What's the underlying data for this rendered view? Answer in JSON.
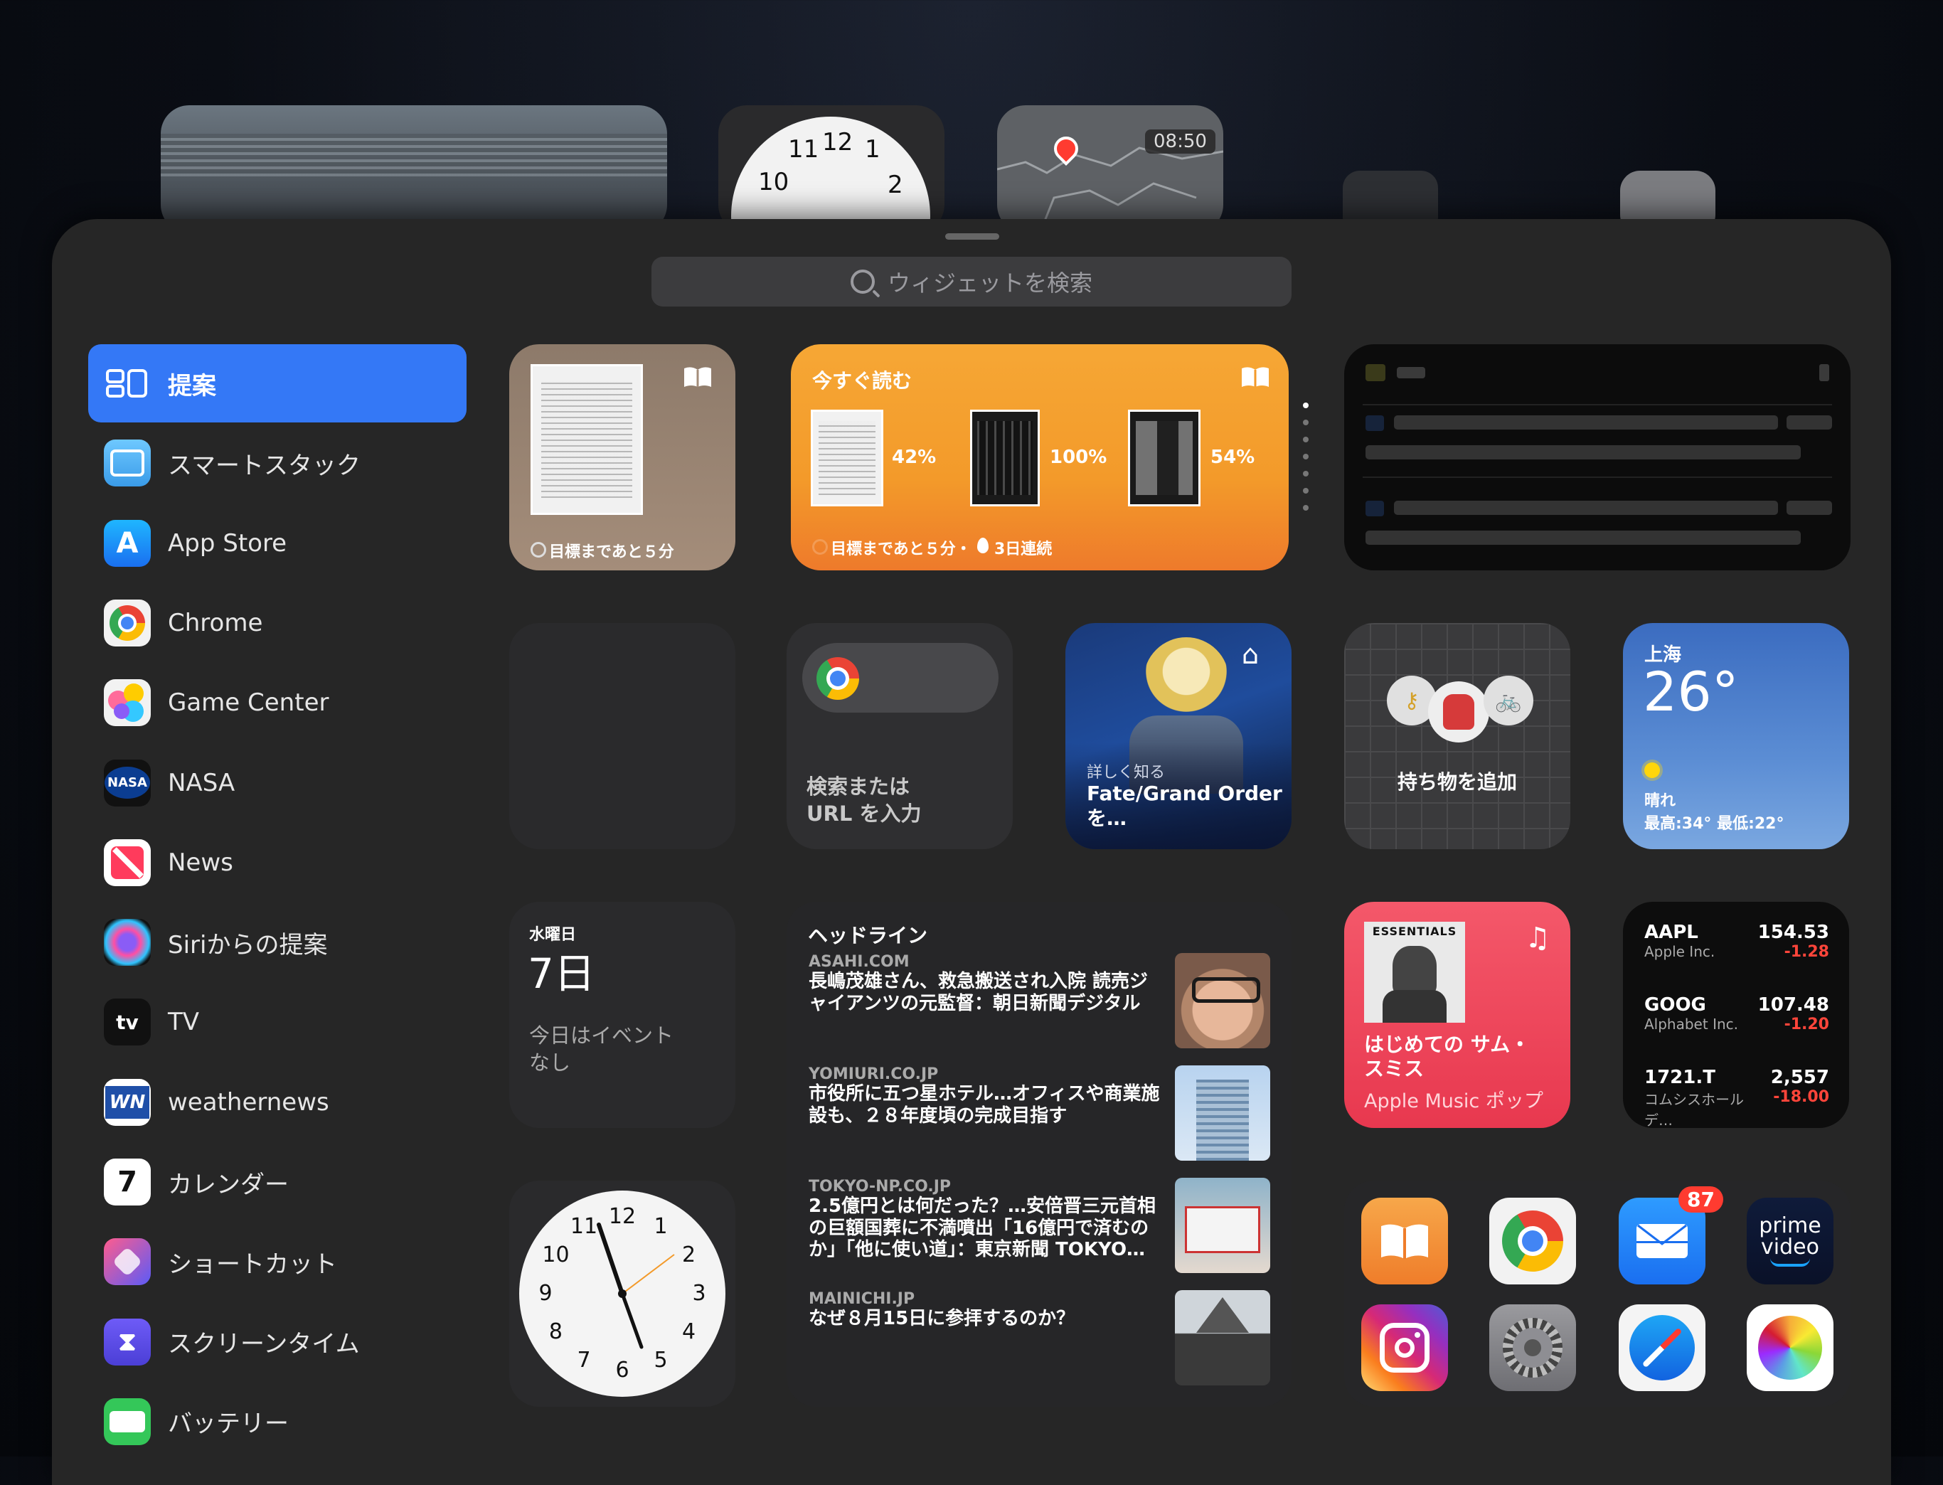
{
  "background": {
    "clock_numbers": [
      "11",
      "12",
      "1",
      "10",
      "2"
    ],
    "map_time": "08:50"
  },
  "search": {
    "placeholder": "ウィジェットを検索"
  },
  "sidebar": {
    "items": [
      {
        "label": "提案",
        "icon": "suggestions-icon",
        "active": true
      },
      {
        "label": "スマートスタック",
        "icon": "smart-stack-icon"
      },
      {
        "label": "App Store",
        "icon": "app-store-icon"
      },
      {
        "label": "Chrome",
        "icon": "chrome-icon"
      },
      {
        "label": "Game Center",
        "icon": "game-center-icon"
      },
      {
        "label": "NASA",
        "icon": "nasa-icon",
        "icon_text": "NASA"
      },
      {
        "label": "News",
        "icon": "news-icon"
      },
      {
        "label": "Siriからの提案",
        "icon": "siri-icon"
      },
      {
        "label": "TV",
        "icon": "tv-icon",
        "icon_text": "tv"
      },
      {
        "label": "weathernews",
        "icon": "weathernews-icon",
        "icon_text": "WN"
      },
      {
        "label": "カレンダー",
        "icon": "calendar-icon",
        "icon_text": "7"
      },
      {
        "label": "ショートカット",
        "icon": "shortcuts-icon"
      },
      {
        "label": "スクリーンタイム",
        "icon": "screen-time-icon"
      },
      {
        "label": "バッテリー",
        "icon": "battery-icon"
      }
    ]
  },
  "books_small": {
    "goal": "目標まであと５分"
  },
  "books_read_now": {
    "title": "今すぐ読む",
    "progress": [
      "42%",
      "100%",
      "54%"
    ],
    "footer": "目標まであと５分・",
    "streak": "3日連続"
  },
  "chrome_widget": {
    "label_line1": "検索または",
    "label_line2": "URL を入力"
  },
  "app_store_widget": {
    "eyebrow": "詳しく知る",
    "title_line1": "Fate/Grand Order",
    "title_line2": "を…"
  },
  "find_my": {
    "label": "持ち物を追加"
  },
  "weather": {
    "city": "上海",
    "temp": "26°",
    "condition": "晴れ",
    "range": "最高:34° 最低:22°"
  },
  "calendar": {
    "weekday": "水曜日",
    "day": "7日",
    "no_events_line1": "今日はイベント",
    "no_events_line2": "なし"
  },
  "news": {
    "header": "ヘッドライン",
    "items": [
      {
        "source": "ASAHI.COM",
        "title": "長嶋茂雄さん、救急搬送され入院 読売ジャイアンツの元監督：朝日新聞デジタル"
      },
      {
        "source": "YOMIURI.CO.JP",
        "title": "市役所に五つ星ホテル…オフィスや商業施設も、２８年度頃の完成目指す"
      },
      {
        "source": "TOKYO-NP.CO.JP",
        "title": "2.5億円とは何だった？…安倍晋三元首相の巨額国葬に不満噴出「16億円で済むのか」「他に使い道」：東京新聞 TOKYO…"
      },
      {
        "source": "MAINICHI.JP",
        "title": "なぜ８月15日に参拝するのか？"
      }
    ]
  },
  "music": {
    "album_label": "ESSENTIALS",
    "title_line1": "はじめての サム・",
    "title_line2": "スミス",
    "subtitle": "Apple Music ポップ"
  },
  "stocks": [
    {
      "symbol": "AAPL",
      "name": "Apple Inc.",
      "price": "154.53",
      "change": "-1.28"
    },
    {
      "symbol": "GOOG",
      "name": "Alphabet Inc.",
      "price": "107.48",
      "change": "-1.20"
    },
    {
      "symbol": "1721.T",
      "name": "コムシスホールデ…",
      "price": "2,557",
      "change": "-18.00"
    }
  ],
  "clock_widget": {
    "numbers": [
      "12",
      "1",
      "2",
      "3",
      "4",
      "5",
      "6",
      "7",
      "8",
      "9",
      "10",
      "11"
    ]
  },
  "app_icons": {
    "mail_badge": "87",
    "prime_line1": "prime",
    "prime_line2": "video",
    "items": [
      "books-icon",
      "chrome-icon",
      "mail-icon",
      "prime-video-icon",
      "instagram-icon",
      "settings-icon",
      "safari-icon",
      "photos-icon"
    ]
  },
  "colors": {
    "accent": "#3478f6",
    "books_orange": "#f5a623",
    "weather_blue": "#3d6fb5",
    "music_red": "#f03a4f",
    "stock_red": "#ff453a"
  }
}
